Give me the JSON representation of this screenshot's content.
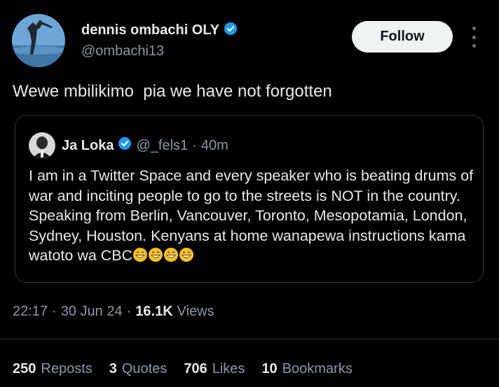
{
  "author": {
    "name": "dennis ombachi OLY",
    "handle": "@ombachi13",
    "verified_color": "#1d9bf0"
  },
  "follow_label": "Follow",
  "tweet_text": "Wewe mbilikimo  pia we have not forgotten",
  "quoted": {
    "name": "Ja Loka",
    "handle": "@_fels1",
    "dot": "·",
    "time": "40m",
    "text": "I am in a Twitter Space and every speaker who is beating drums of war and inciting people to go to the streets is NOT in the country. Speaking from Berlin, Vancouver, Toronto, Mesopotamia, London, Sydney, Houston. Kenyans at home wanapewa instructions kama watoto wa CBC",
    "emojis": [
      "grinning-sweat-face",
      "grinning-sweat-face",
      "grinning-sweat-face",
      "grinning-sweat-face"
    ]
  },
  "meta": {
    "time": "22:17",
    "sep": "·",
    "date": "30 Jun 24",
    "views_count": "16.1K",
    "views_label": "Views"
  },
  "stats": {
    "reposts_count": "250",
    "reposts_label": "Reposts",
    "quotes_count": "3",
    "quotes_label": "Quotes",
    "likes_count": "706",
    "likes_label": "Likes",
    "bookmarks_count": "10",
    "bookmarks_label": "Bookmarks"
  }
}
